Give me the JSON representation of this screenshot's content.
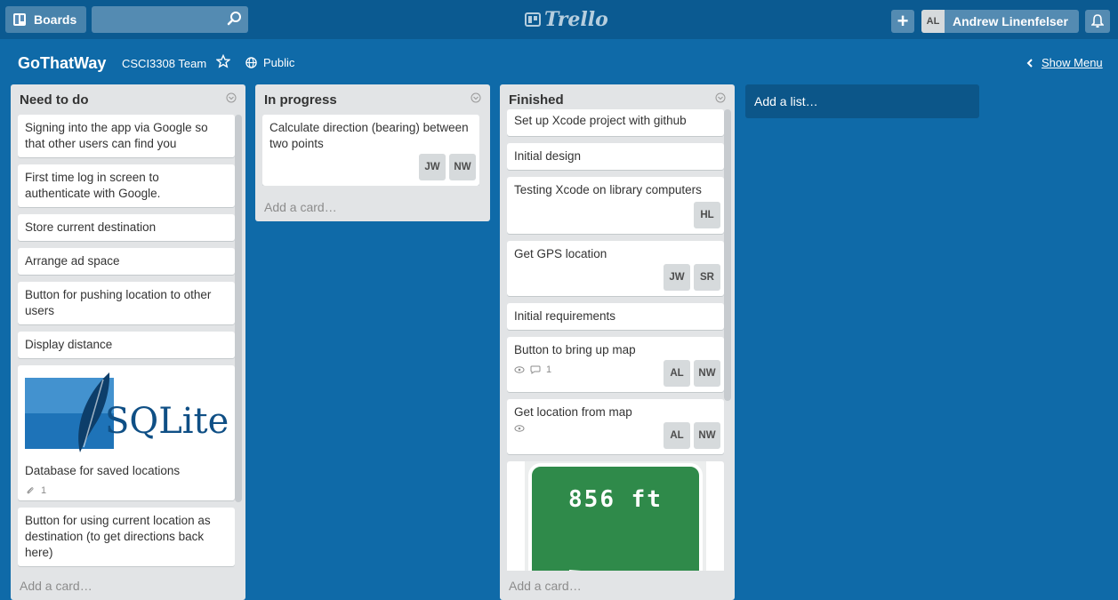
{
  "topbar": {
    "boards_label": "Boards",
    "logo_text": "Trello",
    "plus_label": "+",
    "user_initials": "AL",
    "user_name": "Andrew Linenfelser"
  },
  "board": {
    "title": "GoThatWay",
    "team": "CSCI3308 Team",
    "visibility": "Public",
    "show_menu_label": "Show Menu"
  },
  "lists": [
    {
      "title": "Need to do",
      "add_card_label": "Add a card…",
      "cards": [
        {
          "text": "Signing into the app via Google so that other users can find you"
        },
        {
          "text": "First time log in screen to authenticate with Google."
        },
        {
          "text": "Store current destination"
        },
        {
          "text": "Arrange ad space"
        },
        {
          "text": "Button for pushing location to other users"
        },
        {
          "text": "Display distance"
        },
        {
          "text": "Database for saved locations",
          "cover_text": "SQLite",
          "attachments": "1"
        },
        {
          "text": "Button for using current location as destination (to get directions back here)"
        }
      ]
    },
    {
      "title": "In progress",
      "add_card_label": "Add a card…",
      "cards": [
        {
          "text": "Calculate direction (bearing) between two points",
          "members": [
            "JW",
            "NW"
          ]
        }
      ]
    },
    {
      "title": "Finished",
      "add_card_label": "Add a card…",
      "cards": [
        {
          "text": "Set up Xcode project with github"
        },
        {
          "text": "Initial design"
        },
        {
          "text": "Testing Xcode on library computers",
          "members": [
            "HL"
          ]
        },
        {
          "text": "Get GPS location",
          "members": [
            "JW",
            "SR"
          ]
        },
        {
          "text": "Initial requirements"
        },
        {
          "text": "Button to bring up map",
          "comments": "1",
          "members": [
            "AL",
            "NW"
          ]
        },
        {
          "text": "Get location from map",
          "members": [
            "AL",
            "NW"
          ]
        },
        {
          "cover_text": "856 ft"
        }
      ]
    }
  ],
  "add_list_label": "Add a list…",
  "colors": {
    "board_bg": "#0f6aa8",
    "topbar_bg": "#0b5a91",
    "list_bg": "#e2e4e6",
    "sign_green": "#2f8a4a"
  }
}
